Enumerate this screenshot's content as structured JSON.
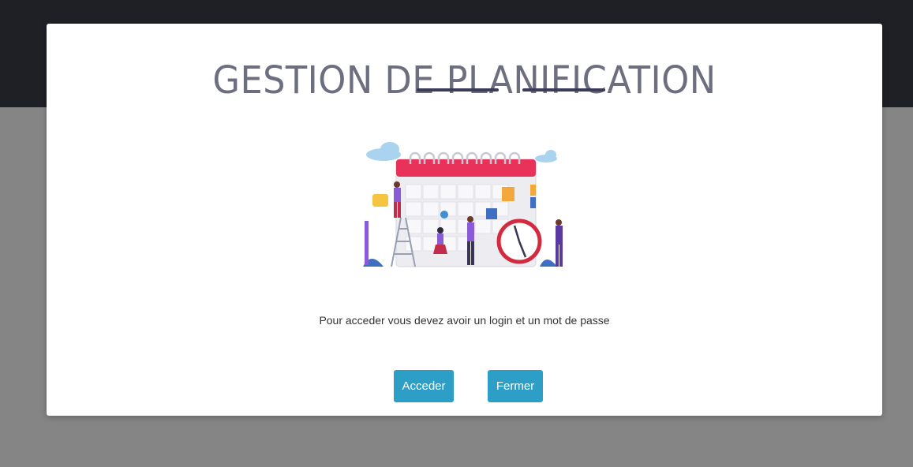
{
  "modal": {
    "title": "GESTION DE PLANIFICATION",
    "illustration_icon": "calendar-planning-illustration-icon",
    "message": "Pour acceder vous devez avoir un login et un mot de passe",
    "buttons": {
      "acceder_label": "Acceder",
      "fermer_label": "Fermer"
    }
  },
  "colors": {
    "topbar": "#1f1f26",
    "backdrop": "#858585",
    "title": "#6d6f80",
    "underline": "#3b3c5a",
    "button": "#2d9fc6"
  }
}
